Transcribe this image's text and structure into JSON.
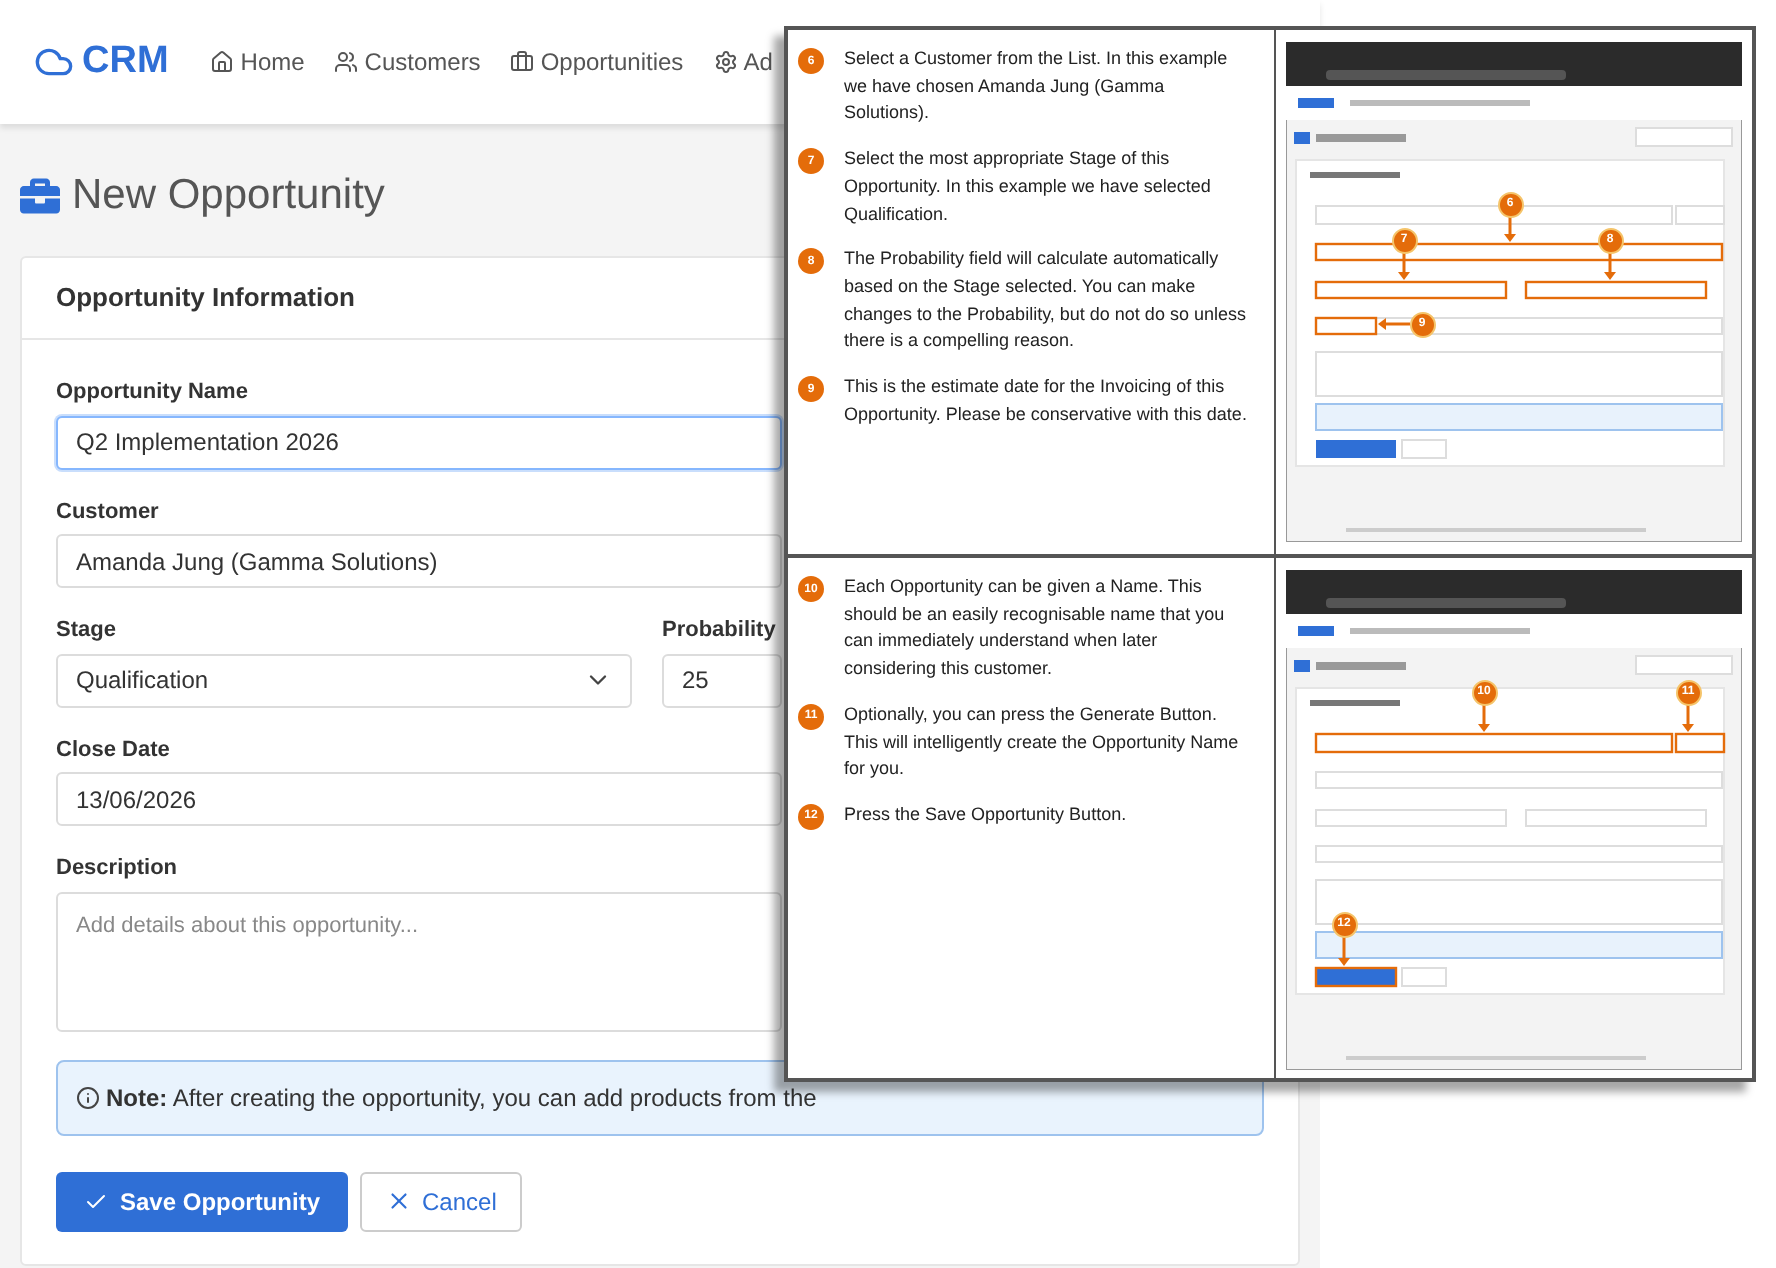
{
  "nav": {
    "brand": "CRM",
    "items": [
      {
        "label": "Home"
      },
      {
        "label": "Customers"
      },
      {
        "label": "Opportunities"
      },
      {
        "label": "Ad"
      }
    ]
  },
  "page_title": "New Opportunity",
  "form": {
    "title": "Opportunity Information",
    "fields": [
      {
        "kind": "text",
        "label": "Opportunity Name",
        "value": "Q2 Implementation 2026",
        "focused": true
      },
      {
        "kind": "text",
        "label": "Customer",
        "value": "Amanda Jung (Gamma Solutions)",
        "focused": false
      },
      {
        "kind": "select",
        "label": "Stage",
        "value": "Qualification",
        "focused": false
      },
      {
        "kind": "text",
        "label": "Probability",
        "value": "25",
        "focused": false
      },
      {
        "kind": "text",
        "label": "Close Date",
        "value": "13/06/2026",
        "focused": false
      },
      {
        "kind": "textarea",
        "label": "Description",
        "placeholder": "Add details about this opportunity...",
        "focused": false
      }
    ],
    "note": "**Note:** After creating the opportunity, you can add products from the",
    "buttons": [
      {
        "label": "Save Opportunity",
        "kind": "primary"
      },
      {
        "label": "Cancel",
        "kind": "secondary"
      }
    ]
  },
  "guide": {
    "panels": [
      {
        "steps": [
          {
            "number": "6",
            "text": "Select a Customer from the List. In this example we have chosen Amanda Jung (Gamma Solutions)."
          },
          {
            "number": "7",
            "text": "Select the most appropriate Stage of this Opportunity. In this example we have selected Qualification."
          },
          {
            "number": "8",
            "text": "The Probability field will calculate automatically based on the Stage selected. You can make changes to the Probability, but do not do so unless there is a compelling reason."
          },
          {
            "number": "9",
            "text": "This is the estimate date for the Invoicing of this Opportunity. Please be conservative with this date."
          }
        ],
        "callouts": [
          "6",
          "7",
          "8",
          "9"
        ]
      },
      {
        "steps": [
          {
            "number": "10",
            "text": "Each Opportunity can be given a Name. This should be an easily recognisable name that you can immediately understand when later considering this customer."
          },
          {
            "number": "11",
            "text": "Optionally, you can press the Generate Button. This will intelligently create the Opportunity Name for you."
          },
          {
            "number": "12",
            "text": "Press the Save Opportunity Button."
          }
        ],
        "callouts": [
          "10",
          "11",
          "12"
        ]
      }
    ]
  }
}
